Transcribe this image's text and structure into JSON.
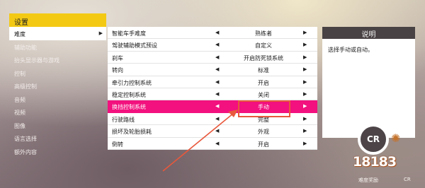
{
  "left_menu": {
    "title": "设置",
    "items": [
      {
        "label": "难度",
        "selected": true,
        "arrow": "▶"
      },
      {
        "label": "辅助功能"
      },
      {
        "label": "抬头显示器与游戏"
      },
      {
        "label": "控制"
      },
      {
        "label": "高级控制"
      },
      {
        "label": "音频"
      },
      {
        "label": "视频"
      },
      {
        "label": "图像"
      },
      {
        "label": "语言选择"
      },
      {
        "label": "额外内容"
      }
    ]
  },
  "settings": [
    {
      "label": "智能车手难度",
      "value": "熟练者",
      "left": "◀",
      "right": "▶"
    },
    {
      "label": "驾驶辅助模式预设",
      "value": "自定义",
      "left": "◀",
      "right": "▶"
    },
    {
      "label": "刹车",
      "value": "开启防死锁系统",
      "left": "◀",
      "right": "▶"
    },
    {
      "label": "转向",
      "value": "标准",
      "left": "◀",
      "right": "▶"
    },
    {
      "label": "牵引力控制系统",
      "value": "开启",
      "left": "◀",
      "right": "▶"
    },
    {
      "label": "稳定控制系统",
      "value": "关闭",
      "left": "◀",
      "right": "▶"
    },
    {
      "label": "换挡控制系统",
      "value": "手动",
      "left": "◀",
      "right": "▶",
      "highlighted": true
    },
    {
      "label": "行驶路线",
      "value": "完整",
      "left": "◀",
      "right": "▶"
    },
    {
      "label": "损坏及轮胎损耗",
      "value": "外观",
      "left": "◀",
      "right": "▶"
    },
    {
      "label": "倒转",
      "value": "开启",
      "left": "◀",
      "right": "▶"
    }
  ],
  "description": {
    "title": "说明",
    "text": "选择手动或自动。"
  },
  "badge": {
    "logo": "CR",
    "caption": "难度奖励",
    "caption_suffix": "CR"
  },
  "watermark": "18183",
  "colors": {
    "menu_header": "#f3c914",
    "highlight": "#f2117e",
    "annotation": "#e8583c",
    "description_header": "#494244"
  }
}
